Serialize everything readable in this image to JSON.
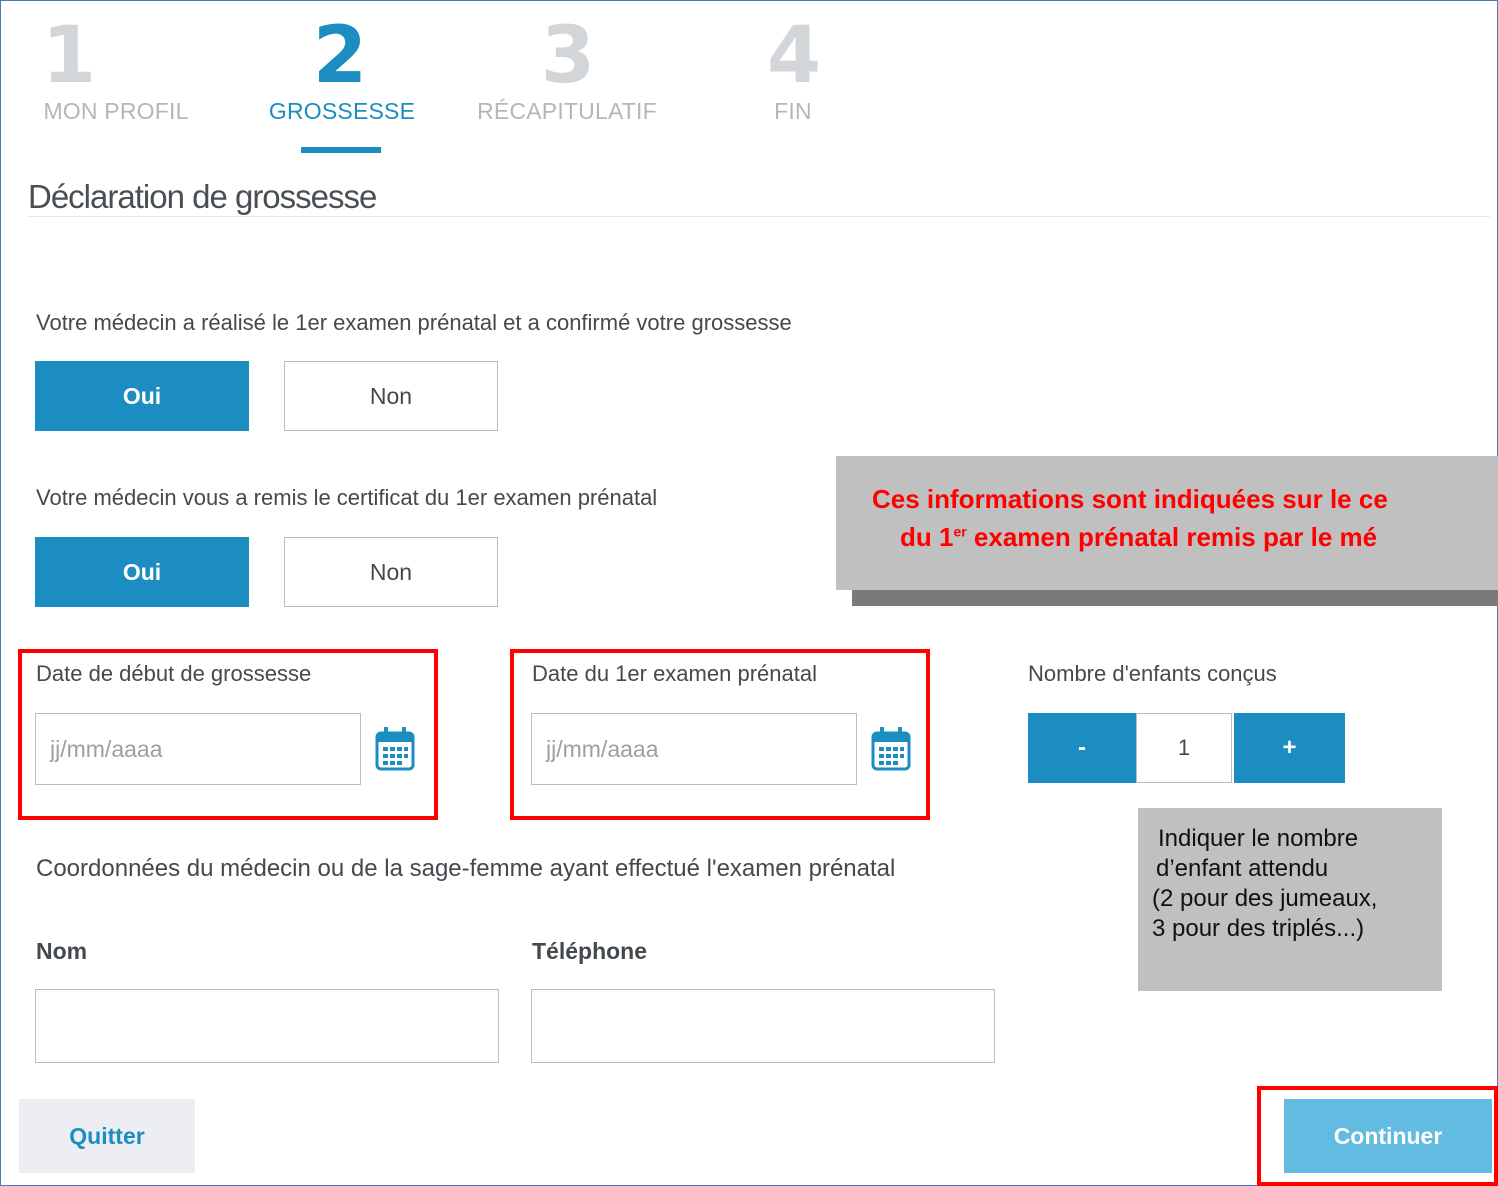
{
  "steps": [
    {
      "number": "1",
      "label": "MON PROFIL"
    },
    {
      "number": "2",
      "label": "GROSSESSE"
    },
    {
      "number": "3",
      "label": "RÉCAPITULATIF"
    },
    {
      "number": "4",
      "label": "FIN"
    }
  ],
  "active_step": "2",
  "page_title": "Déclaration de grossesse",
  "question1": {
    "label": "Votre médecin a réalisé le 1er examen prénatal et a confirmé votre grossesse",
    "yes": "Oui",
    "no": "Non",
    "selected": "Oui"
  },
  "question2": {
    "label": "Votre médecin vous a remis le certificat du 1er examen prénatal",
    "yes": "Oui",
    "no": "Non",
    "selected": "Oui"
  },
  "callout": {
    "line1": "Ces informations sont indiquées sur le ce",
    "line2_prefix": "du 1",
    "line2_sup": "er",
    "line2_suffix": " examen prénatal remis par le mé"
  },
  "start_date": {
    "label": "Date de début de grossesse",
    "placeholder": "jj/mm/aaaa"
  },
  "exam_date": {
    "label": "Date du 1er examen prénatal",
    "placeholder": "jj/mm/aaaa"
  },
  "children": {
    "label": "Nombre d'enfants conçus",
    "minus": "-",
    "value": "1",
    "plus": "+"
  },
  "note": [
    "Indiquer le nombre",
    "d’enfant attendu",
    "(2 pour des jumeaux,",
    "3 pour des triplés...)"
  ],
  "practitioner": {
    "title": "Coordonnées du médecin ou de la sage-femme ayant effectué l'examen prénatal",
    "name_label": "Nom",
    "phone_label": "Téléphone",
    "name_value": "",
    "phone_value": ""
  },
  "footer": {
    "quit": "Quitter",
    "continue": "Continuer"
  },
  "colors": {
    "primary": "#1b8dc0",
    "continue": "#62bbe0",
    "highlight": "#ff0000",
    "callout_bg": "#c0c0c0"
  }
}
